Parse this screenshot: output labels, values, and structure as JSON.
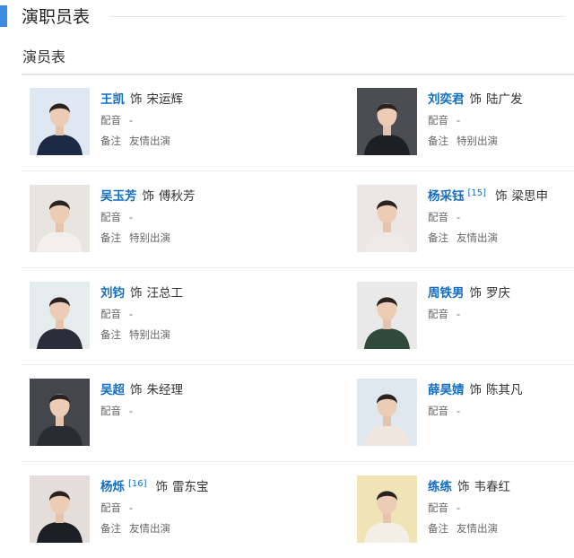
{
  "section": {
    "title": "演职员表"
  },
  "subsection": {
    "title": "演员表"
  },
  "shi_label": "饰",
  "dub_label": "配音",
  "note_label": "备注",
  "cast": [
    {
      "actor": "王凯",
      "ref": "",
      "role": "宋运辉",
      "dub": "-",
      "note": "友情出演",
      "bg": "#dfe7f2",
      "cloth": "#1d2a45"
    },
    {
      "actor": "刘奕君",
      "ref": "",
      "role": "陆广发",
      "dub": "-",
      "note": "特别出演",
      "bg": "#4a4d52",
      "cloth": "#1e1f22"
    },
    {
      "actor": "吴玉芳",
      "ref": "",
      "role": "傅秋芳",
      "dub": "-",
      "note": "特别出演",
      "bg": "#e8e4df",
      "cloth": "#f2f0ec"
    },
    {
      "actor": "杨采钰",
      "ref": "[15]",
      "role": "梁思申",
      "dub": "-",
      "note": "友情出演",
      "bg": "#ece6e4",
      "cloth": "#efe9e6"
    },
    {
      "actor": "刘钧",
      "ref": "",
      "role": "汪总工",
      "dub": "-",
      "note": "特别出演",
      "bg": "#e4ecee",
      "cloth": "#2a2e3a"
    },
    {
      "actor": "周铁男",
      "ref": "",
      "role": "罗庆",
      "dub": "-",
      "note": "",
      "bg": "#e9e9ea",
      "cloth": "#2f4a3a"
    },
    {
      "actor": "吴超",
      "ref": "",
      "role": "朱经理",
      "dub": "-",
      "note": "",
      "bg": "#43464c",
      "cloth": "#2a2c33"
    },
    {
      "actor": "薛昊婧",
      "ref": "",
      "role": "陈其凡",
      "dub": "-",
      "note": "",
      "bg": "#dfe8ef",
      "cloth": "#f0e6e0"
    },
    {
      "actor": "杨烁",
      "ref": "[16]",
      "role": "雷东宝",
      "dub": "-",
      "note": "友情出演",
      "bg": "#e4ddd9",
      "cloth": "#1d1f26"
    },
    {
      "actor": "练练",
      "ref": "",
      "role": "韦春红",
      "dub": "-",
      "note": "友情出演",
      "bg": "#f0e3b5",
      "cloth": "#f3efe6"
    }
  ]
}
